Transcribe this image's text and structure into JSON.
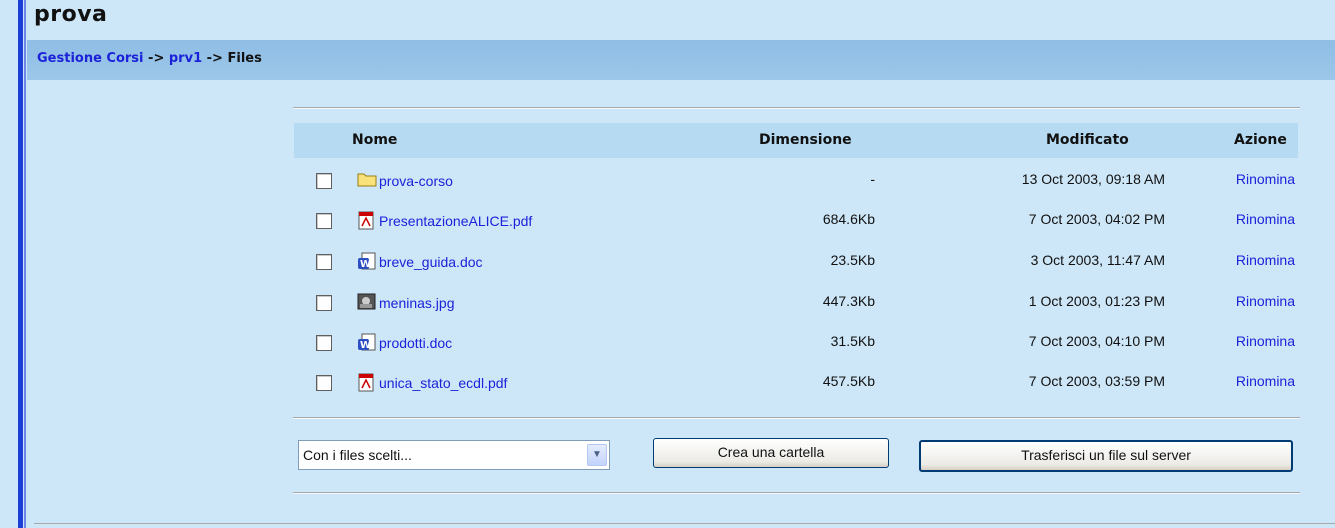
{
  "page_title": "prova",
  "breadcrumb": {
    "items": [
      "Gestione Corsi",
      "prv1"
    ],
    "separator": "->",
    "current": "Files"
  },
  "table": {
    "headers": {
      "name": "Nome",
      "size": "Dimensione",
      "modified": "Modificato",
      "action": "Azione"
    },
    "rows": [
      {
        "icon": "folder-icon",
        "name": "prova-corso",
        "size": "-",
        "modified": "13 Oct 2003, 09:18 AM",
        "action": "Rinomina"
      },
      {
        "icon": "pdf-icon",
        "name": "PresentazioneALICE.pdf",
        "size": "684.6Kb",
        "modified": "7 Oct 2003, 04:02 PM",
        "action": "Rinomina"
      },
      {
        "icon": "word-doc-icon",
        "name": "breve_guida.doc",
        "size": "23.5Kb",
        "modified": "3 Oct 2003, 11:47 AM",
        "action": "Rinomina"
      },
      {
        "icon": "image-icon",
        "name": "meninas.jpg",
        "size": "447.3Kb",
        "modified": "1 Oct 2003, 01:23 PM",
        "action": "Rinomina"
      },
      {
        "icon": "word-doc-icon",
        "name": "prodotti.doc",
        "size": "31.5Kb",
        "modified": "7 Oct 2003, 04:10 PM",
        "action": "Rinomina"
      },
      {
        "icon": "pdf-icon",
        "name": "unica_stato_ecdl.pdf",
        "size": "457.5Kb",
        "modified": "7 Oct 2003, 03:59 PM",
        "action": "Rinomina"
      }
    ]
  },
  "controls": {
    "select_value": "Con i files scelti...",
    "create_folder_label": "Crea una cartella",
    "upload_label": "Trasferisci un file sul server"
  },
  "colors": {
    "link": "#1b22d9",
    "background": "#cde7f8",
    "navbar": "#94c1e6",
    "header_row": "#b6daf2"
  }
}
